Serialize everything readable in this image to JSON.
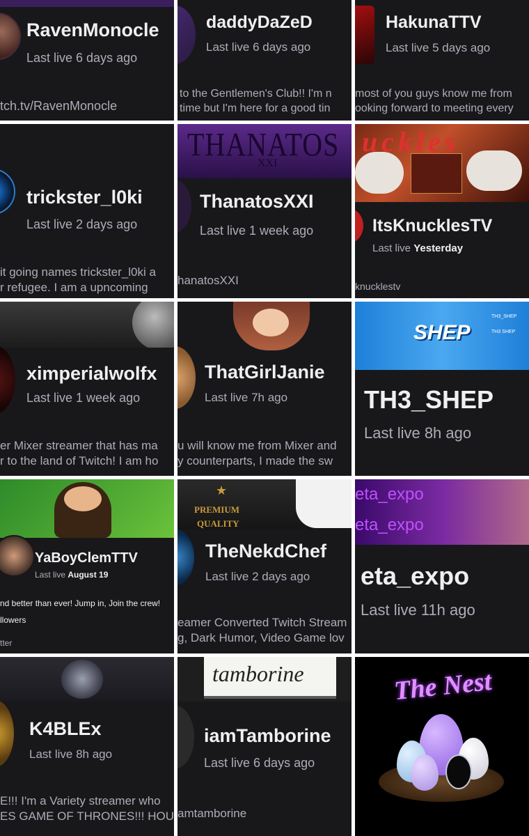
{
  "cards": [
    {
      "name": "RavenMonocle",
      "last": "Last live 6 days ago",
      "desc": [],
      "link": "tch.tv/RavenMonocle"
    },
    {
      "name": "daddyDaZeD",
      "last": "Last live 6 days ago",
      "desc": [
        "to the Gentlemen's Club!! I'm n",
        "time but I'm here for a good tin"
      ],
      "link": ""
    },
    {
      "name": "HakunaTTV",
      "last": "Last live 5 days ago",
      "desc": [
        "most of you guys know me from",
        "ooking forward to meeting every"
      ],
      "link": ""
    },
    {
      "name": "trickster_l0ki",
      "last": "Last live 2 days ago",
      "desc": [
        "it going names trickster_l0ki a",
        "r refugee. I am a upncoming"
      ],
      "link": ""
    },
    {
      "name": "ThanatosXXI",
      "last": "Last live 1 week ago",
      "desc": [],
      "link": "hanatosXXI",
      "banner_text": "THANATOS",
      "banner_sub": "XXI"
    },
    {
      "name": "ItsKnucklesTV",
      "last_prefix": "Last live ",
      "last_bold": "Yesterday",
      "desc": [],
      "link": "knucklestv",
      "banner_text": "uckles"
    },
    {
      "name": "ximperialwolfx",
      "last": "Last live 1 week ago",
      "desc": [
        "er Mixer streamer that has ma",
        "r to the land of Twitch! I am ho"
      ],
      "link": ""
    },
    {
      "name": "ThatGirlJanie",
      "last": "Last live 7h ago",
      "desc": [
        "u will know me from Mixer and",
        "y counterparts, I made the sw"
      ],
      "link": ""
    },
    {
      "name": "TH3_SHEP",
      "last": "Last live 8h ago",
      "desc": [],
      "link": "",
      "banner_text": "SHEP",
      "banner_small": [
        "TH3_SHEP",
        "TH3 SHEP"
      ]
    },
    {
      "name": "YaBoyClemTTV",
      "last_prefix": "Last live ",
      "last_bold": "August 19",
      "desc": [
        "nd better than ever! Jump in, Join the crew!"
      ],
      "followers": "llowers",
      "link": "tter"
    },
    {
      "name": "TheNekdChef",
      "last": "Last live 2 days ago",
      "desc": [
        "eamer Converted Twitch Stream",
        "g, Dark Humor, Video Game lov"
      ],
      "link": "",
      "banner_text": [
        "PREMIUM",
        "QUALITY"
      ]
    },
    {
      "name": "eta_expo",
      "last": "Last live 11h ago",
      "desc": [],
      "link": "",
      "banner_text": [
        "eta_expo",
        "eta_expo"
      ]
    },
    {
      "name": "K4BLEx",
      "last": "Last live 8h ago",
      "desc": [
        "E!!! I'm a Variety streamer who",
        "ES GAME OF THRONES!!! HOU"
      ],
      "link": ""
    },
    {
      "name": "iamTamborine",
      "last": "Last live 6 days ago",
      "desc": [],
      "link": "amtamborine",
      "banner_text": "tamborine"
    },
    {
      "logo": "The Nest"
    }
  ],
  "colors": {
    "background": "#18181b",
    "text": "#efeff1",
    "muted": "#adadb8",
    "twitch_purple": "#9147ff"
  }
}
